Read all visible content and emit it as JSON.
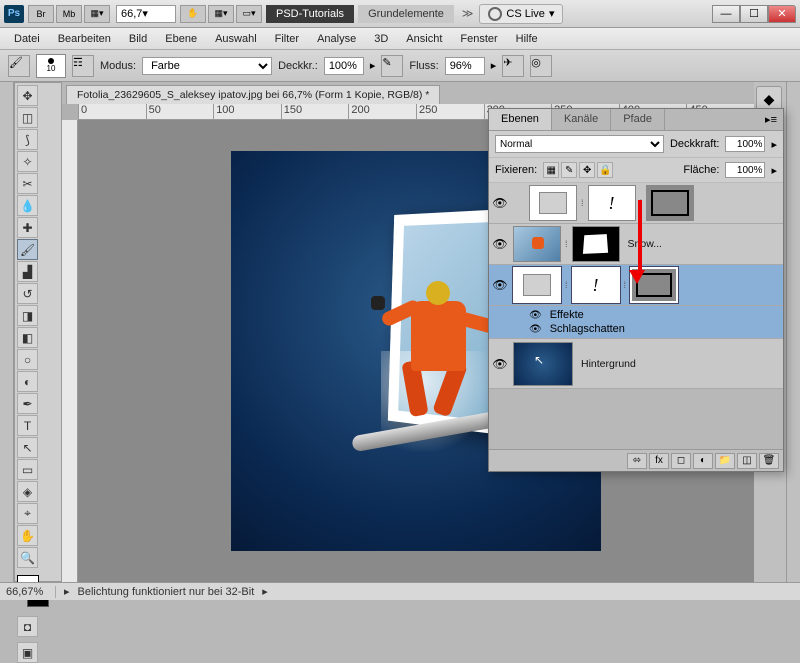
{
  "titlebar": {
    "ps": "Ps",
    "br": "Br",
    "mb": "Mb",
    "zoom": "66,7",
    "tab1": "PSD-Tutorials",
    "tab2": "Grundelemente",
    "cslive": "CS Live"
  },
  "menu": [
    "Datei",
    "Bearbeiten",
    "Bild",
    "Ebene",
    "Auswahl",
    "Filter",
    "Analyse",
    "3D",
    "Ansicht",
    "Fenster",
    "Hilfe"
  ],
  "options": {
    "brush_size": "10",
    "modus_label": "Modus:",
    "modus_value": "Farbe",
    "deck_label": "Deckkr.:",
    "deck_value": "100%",
    "fluss_label": "Fluss:",
    "fluss_value": "96%"
  },
  "doc": {
    "tab": "Fotolia_23629605_S_aleksey ipatov.jpg bei 66,7% (Form 1 Kopie, RGB/8) *",
    "ruler_ticks": [
      "0",
      "50",
      "100",
      "150",
      "200",
      "250",
      "300",
      "350",
      "400",
      "450"
    ]
  },
  "panel": {
    "tabs": {
      "ebenen": "Ebenen",
      "kanale": "Kanäle",
      "pfade": "Pfade"
    },
    "blend": "Normal",
    "deck_label": "Deckkraft:",
    "deck": "100%",
    "fix_label": "Fixieren:",
    "flache_label": "Fläche:",
    "flache": "100%",
    "layers": {
      "snow": "Snow...",
      "effekte": "Effekte",
      "schlag": "Schlagschatten",
      "hintergrund": "Hintergrund"
    }
  },
  "status": {
    "zoom": "66,67%",
    "msg": "Belichtung funktioniert nur bei 32-Bit"
  }
}
